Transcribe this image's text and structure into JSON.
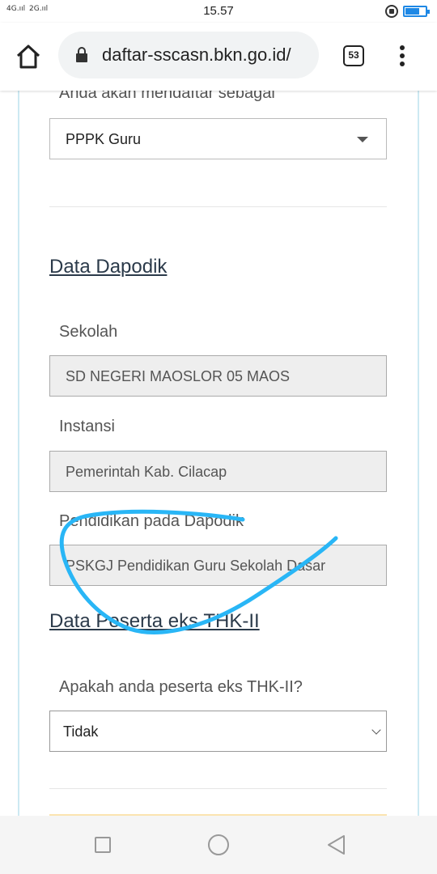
{
  "status_bar": {
    "signal_left": "4G",
    "signal_right": "2G",
    "time": "15.57"
  },
  "browser": {
    "url": "daftar-sscasn.bkn.go.id/",
    "tab_count": "53",
    "icons": [
      "home-icon",
      "lock-icon",
      "tabs-icon",
      "more-vert-icon"
    ]
  },
  "form": {
    "register_as_label": "Anda akan mendaftar sebagai",
    "register_as_value": "PPPK Guru",
    "dapodik_section": "Data Dapodik",
    "school_label": "Sekolah",
    "school_value": "SD NEGERI MAOSLOR 05 MAOS",
    "agency_label": "Instansi",
    "agency_value": "Pemerintah Kab. Cilacap",
    "education_label": "Pendidikan pada Dapodik",
    "education_value": "PSKGJ Pendidikan Guru Sekolah Dasar",
    "thk_section": "Data Peserta eks THK-II",
    "thk_question": "Apakah anda peserta eks THK-II?",
    "thk_value": "Tidak"
  },
  "annotation": {
    "color": "#29b6f6"
  },
  "nav_bar": {
    "icons": [
      "recent-apps-icon",
      "home-circle-icon",
      "back-icon"
    ]
  }
}
